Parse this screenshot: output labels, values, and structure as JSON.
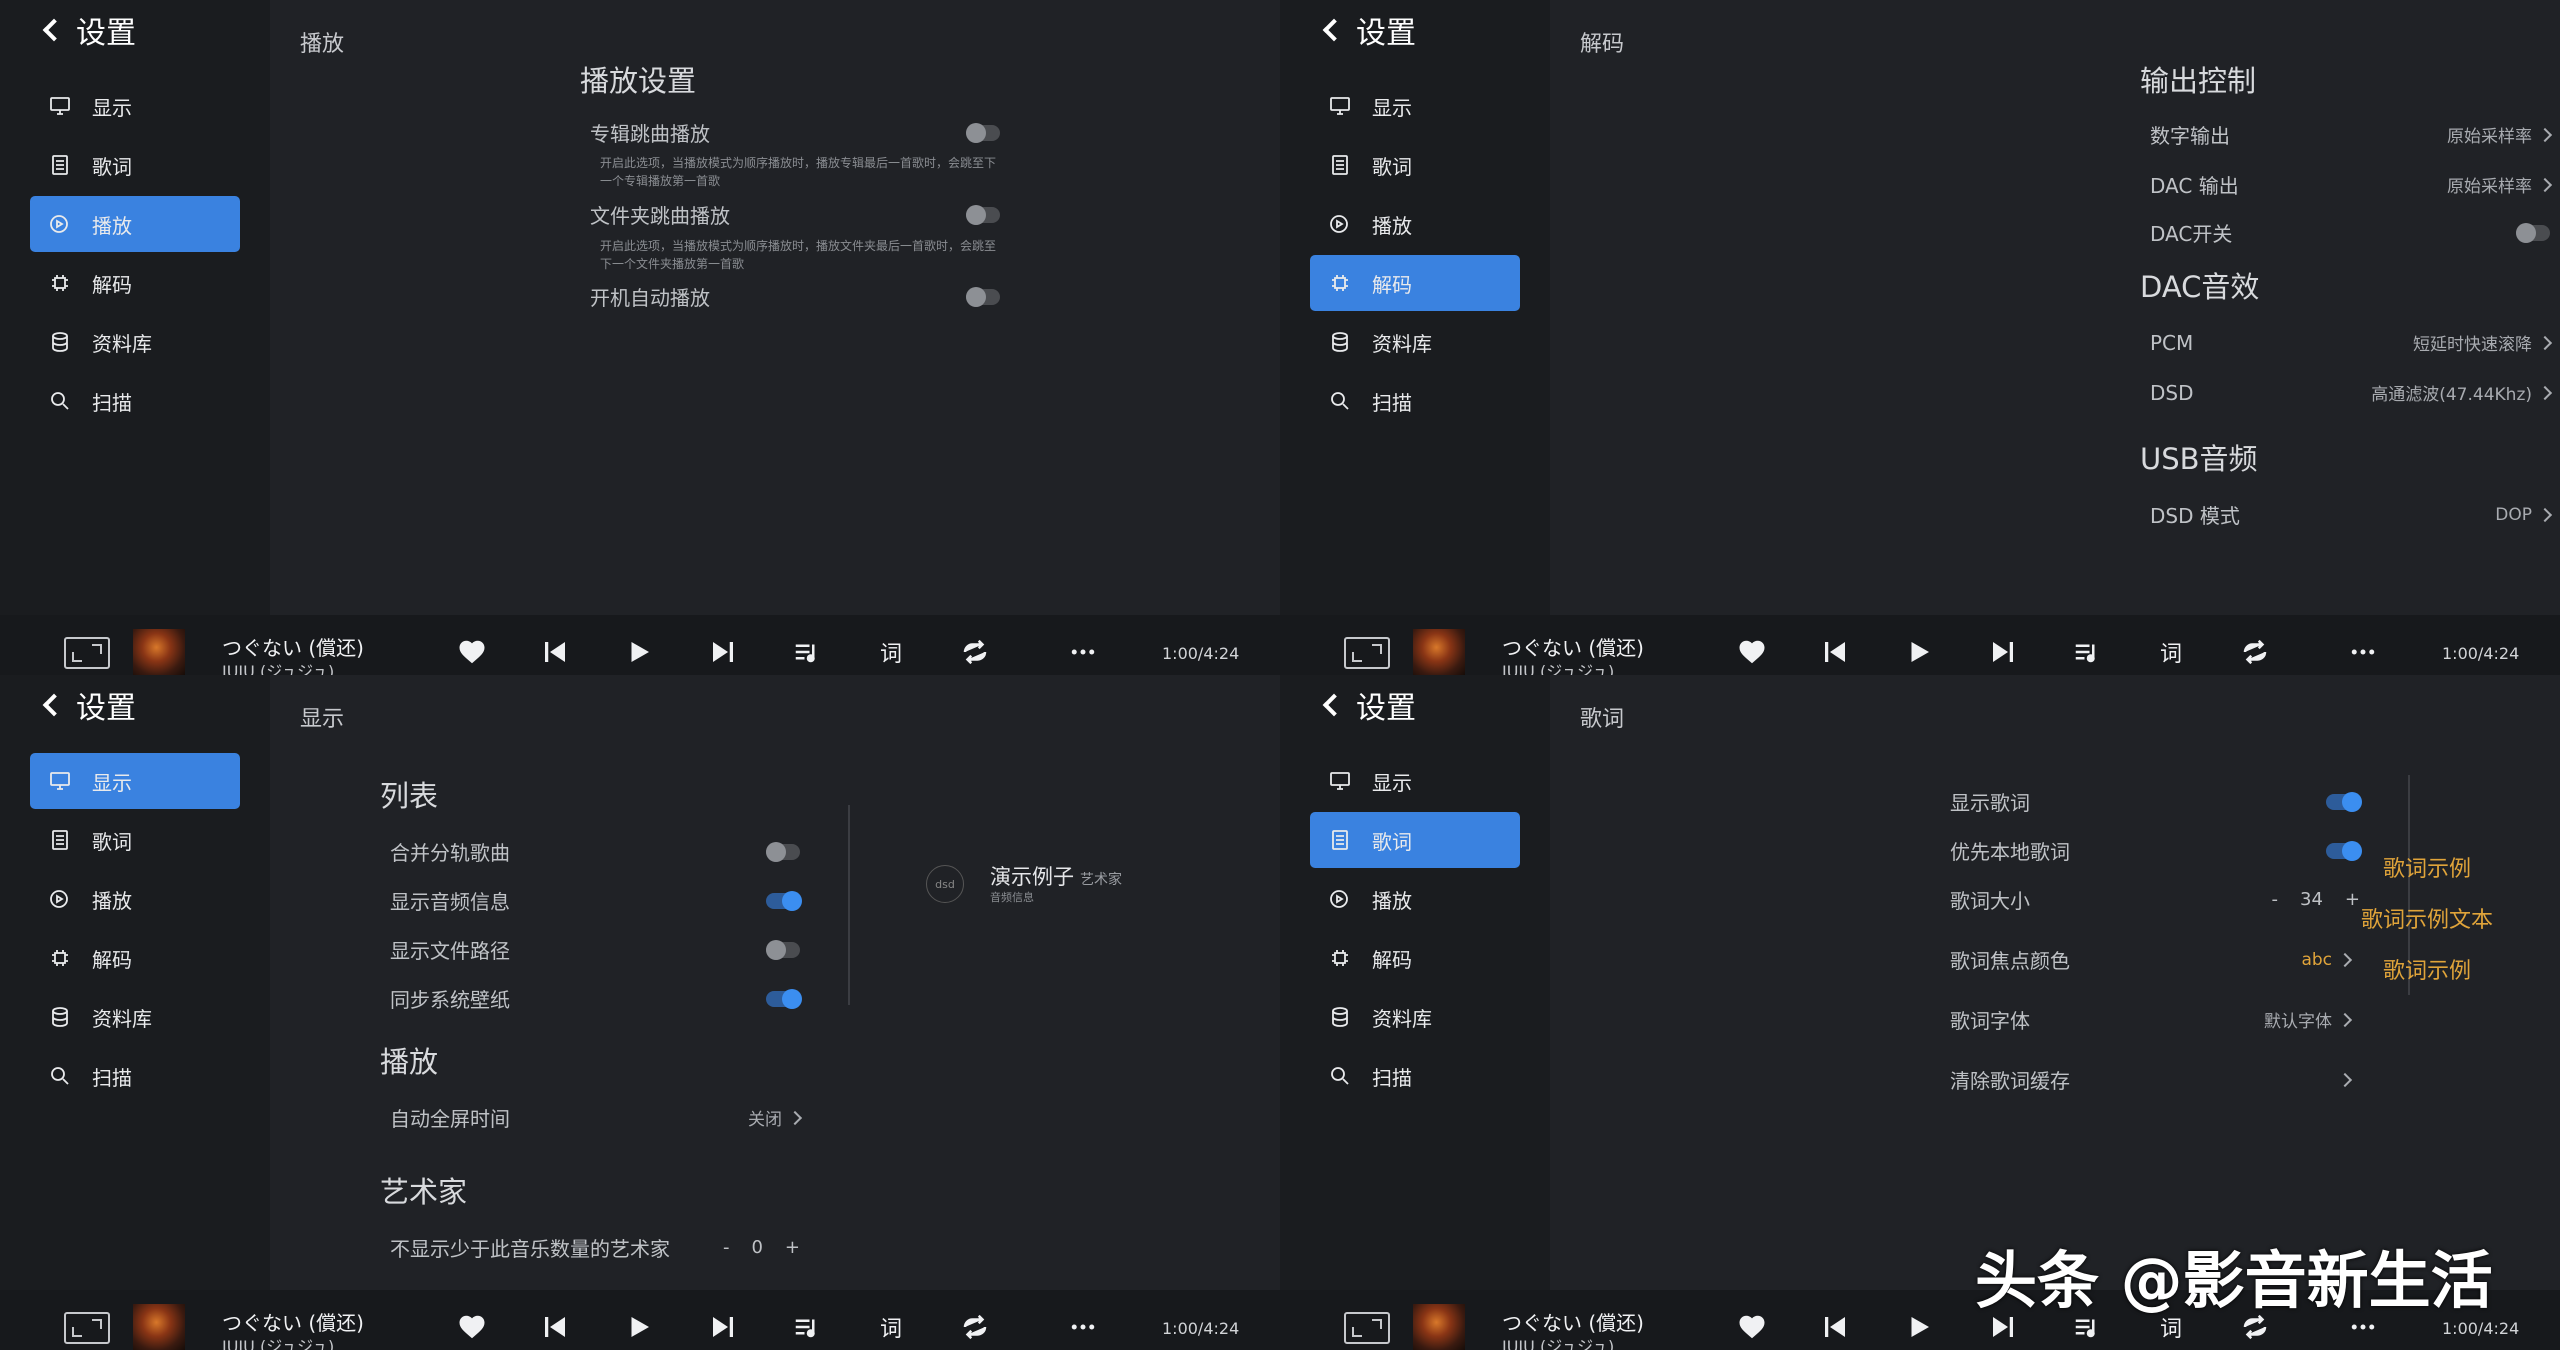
{
  "settings_title": "设置",
  "nav": [
    "显示",
    "歌词",
    "播放",
    "解码",
    "资料库",
    "扫描"
  ],
  "player": {
    "song": "つぐない (償还)",
    "artist": "JUJU (ジュジュ)",
    "lyrics_button": "词",
    "time": "1:00/4:24"
  },
  "playback_panel": {
    "crumb": "播放",
    "section": "播放设置",
    "rows": [
      {
        "label": "专辑跳曲播放",
        "desc1": "开启此选项，当播放模式为顺序播放时，播放专辑最后一首歌时，会跳至下",
        "desc2": "一个专辑播放第一首歌"
      },
      {
        "label": "文件夹跳曲播放",
        "desc1": "开启此选项，当播放模式为顺序播放时，播放文件夹最后一首歌时，会跳至",
        "desc2": "下一个文件夹播放第一首歌"
      },
      {
        "label": "开机自动播放"
      }
    ]
  },
  "decode_panel": {
    "crumb": "解码",
    "output_title": "输出控制",
    "digital_out": {
      "label": "数字输出",
      "value": "原始采样率"
    },
    "dac_out": {
      "label": "DAC 输出",
      "value": "原始采样率"
    },
    "dac_switch": {
      "label": "DAC开关"
    },
    "dac_effect_title": "DAC音效",
    "pcm": {
      "label": "PCM",
      "value": "短延时快速滚降"
    },
    "dsd": {
      "label": "DSD",
      "value": "高通滤波(47.44Khz)"
    },
    "usb_title": "USB音频",
    "dsd_mode": {
      "label": "DSD 模式",
      "value": "DOP"
    }
  },
  "display_panel": {
    "crumb": "显示",
    "list_title": "列表",
    "merge": "合并分轨歌曲",
    "show_audio": "显示音频信息",
    "show_path": "显示文件路径",
    "sync_wall": "同步系统壁纸",
    "play_title": "播放",
    "fullscreen": {
      "label": "自动全屏时间",
      "value": "关闭"
    },
    "artist_title": "艺术家",
    "hide_artist": {
      "label": "不显示少于此音乐数量的艺术家",
      "minus": "-",
      "value": "0",
      "plus": "+"
    },
    "demo": {
      "dsd": "dsd",
      "name": "演示例子",
      "artist": "艺术家",
      "info": "音频信息"
    }
  },
  "lyrics_panel": {
    "crumb": "歌词",
    "show_lyrics": "显示歌词",
    "prefer_local": "优先本地歌词",
    "size": {
      "label": "歌词大小",
      "minus": "-",
      "value": "34",
      "plus": "+"
    },
    "focus_color": {
      "label": "歌词焦点颜色",
      "value": "abc"
    },
    "font": {
      "label": "歌词字体",
      "value": "默认字体"
    },
    "clear_cache": {
      "label": "清除歌词缓存"
    },
    "examples": [
      "歌词示例",
      "歌词示例文本",
      "歌词示例"
    ]
  },
  "watermark": "头条 @影音新生活",
  "colors": {
    "accent": "#3a82e0",
    "lyric_example": "#e0a43a"
  }
}
